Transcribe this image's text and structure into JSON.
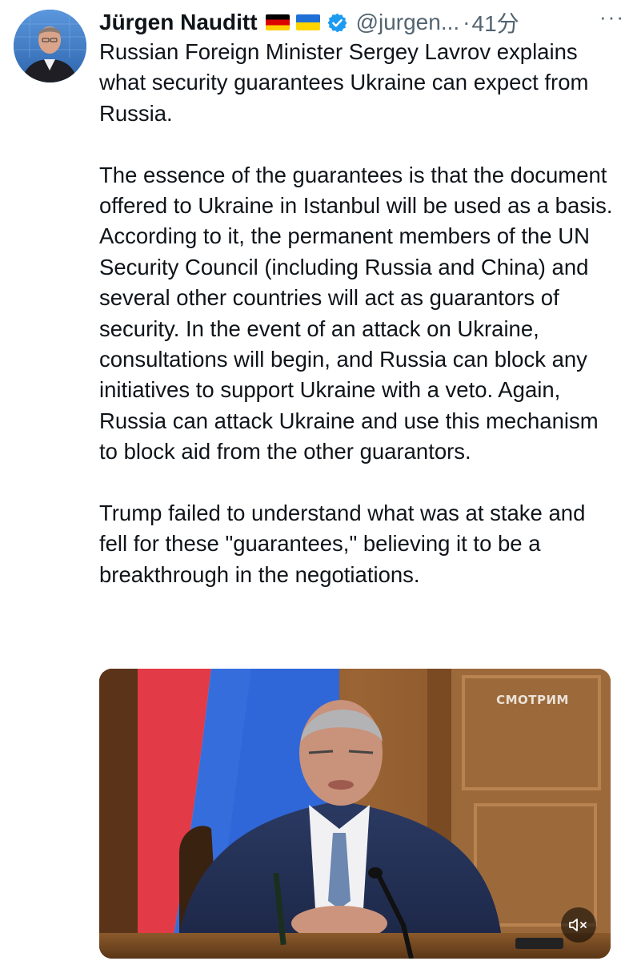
{
  "tweet": {
    "author": {
      "display_name": "Jürgen Nauditt",
      "flags": [
        "germany-flag",
        "ukraine-flag"
      ],
      "verified": true,
      "handle": "@jurgen...",
      "separator": "·",
      "time": "41分"
    },
    "more_label": "···",
    "paragraphs": [
      "Russian Foreign Minister Sergey Lavrov explains what security guarantees Ukraine can expect from Russia.",
      "The essence of the guarantees is that the document offered to Ukraine in Istanbul will be used as a basis. According to it, the permanent members of the UN Security Council (including Russia and China) and several other countries will act as guarantors of security. In the event of an attack on Ukraine, consultations will begin, and Russia can block any initiatives to support Ukraine with a veto. Again, Russia can attack Ukraine and use this mechanism to block aid from the other guarantors.",
      "Trump failed to understand what was at stake and fell for these \"guarantees,\" believing it to be a breakthrough in the negotiations."
    ],
    "media": {
      "watermark": "СМОТРИМ",
      "mute_icon": "speaker-muted-icon"
    }
  },
  "colors": {
    "text": "#0f1419",
    "secondary": "#536471",
    "verified": "#1d9bf0"
  }
}
